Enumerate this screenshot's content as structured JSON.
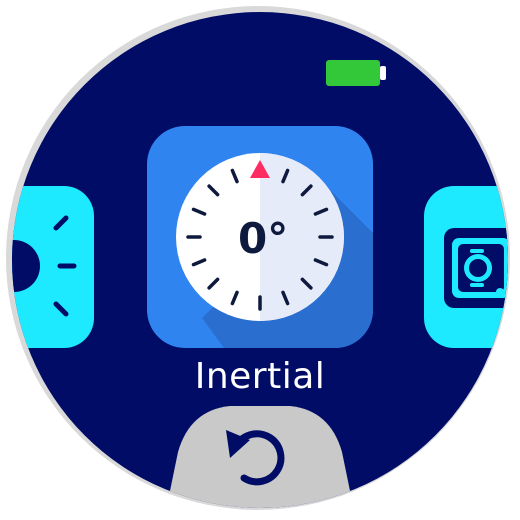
{
  "apps": {
    "current": {
      "label": "Inertial",
      "icon": "compass-icon",
      "heading_display": "0°"
    },
    "previous": {
      "icon": "brightness-icon"
    },
    "next": {
      "icon": "watch-face-icon"
    }
  },
  "status_bar": {
    "battery_icon": "battery-full-icon",
    "battery_color": "#33c83a"
  },
  "back_button": {
    "icon": "back-arrow-icon"
  },
  "colors": {
    "screen_background": "#000c66",
    "current_app_tile": "#2f84f0",
    "side_app_tile": "#1de9ff",
    "heading_marker": "#ff2c62",
    "back_button_bg": "#c9c9c9"
  }
}
